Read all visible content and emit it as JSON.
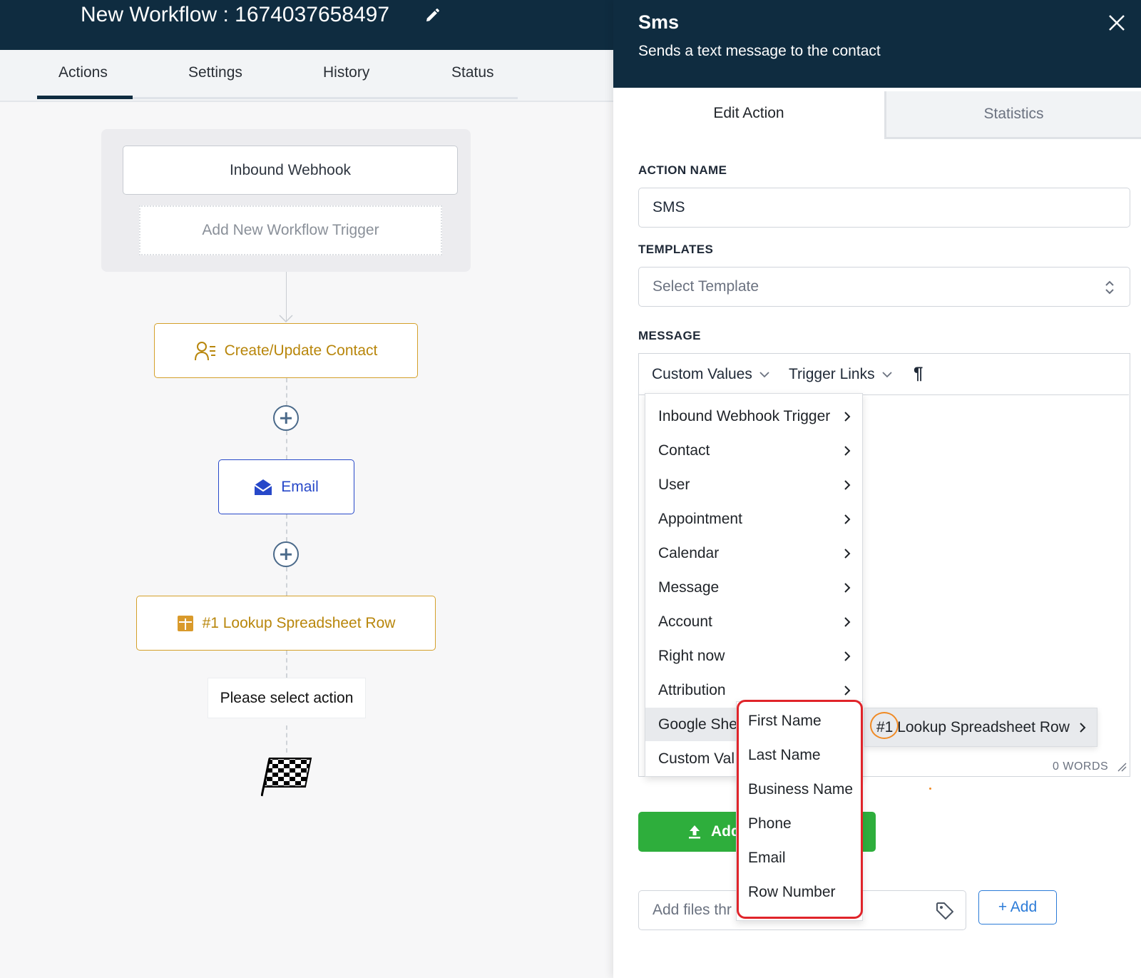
{
  "workflow": {
    "title": "New Workflow : 1674037658497",
    "tabs": [
      "Actions",
      "Settings",
      "History",
      "Status"
    ],
    "active_tab": "Actions",
    "triggers": {
      "webhook_label": "Inbound Webhook",
      "add_trigger_label": "Add New Workflow Trigger"
    },
    "nodes": {
      "create_contact": "Create/Update Contact",
      "email": "Email",
      "lookup": "#1 Lookup Spreadsheet Row",
      "select_action": "Please select action"
    },
    "colors": {
      "header": "#0f2c40",
      "gold": "#b8860b",
      "blue": "#2748c9"
    },
    "icons": [
      "edit-pencil-icon",
      "contact-icon",
      "envelope-icon",
      "spreadsheet-icon",
      "add-step-icon",
      "finish-flag-icon"
    ]
  },
  "panel": {
    "title": "Sms",
    "subtitle": "Sends a text message to the contact",
    "tabs": {
      "edit": "Edit Action",
      "stats": "Statistics"
    },
    "action_name_label": "ACTION NAME",
    "action_name_value": "SMS",
    "templates_label": "TEMPLATES",
    "templates_placeholder": "Select Template",
    "message_label": "MESSAGE",
    "toolbar": {
      "custom_values": "Custom Values",
      "trigger_links": "Trigger Links",
      "paragraph": "¶"
    },
    "word_count": "0 WORDS",
    "upload_label": "Add",
    "attach_placeholder": "Add files thr",
    "add_button": "+ Add",
    "colors": {
      "upload": "#2eae3c",
      "add_button": "#2b7bd8",
      "highlight": "#e0242a",
      "circle": "#f08a24"
    }
  },
  "custom_values_menu": [
    {
      "label": "Inbound Webhook Trigger"
    },
    {
      "label": "Contact"
    },
    {
      "label": "User"
    },
    {
      "label": "Appointment"
    },
    {
      "label": "Calendar"
    },
    {
      "label": "Message"
    },
    {
      "label": "Account"
    },
    {
      "label": "Right now"
    },
    {
      "label": "Attribution"
    },
    {
      "label": "Google She",
      "active": true
    },
    {
      "label": "Custom Val"
    }
  ],
  "google_sheets_submenu": {
    "label": "#1 Lookup Spreadsheet Row"
  },
  "field_menu": [
    "First Name",
    "Last Name",
    "Business Name",
    "Phone",
    "Email",
    "Row Number"
  ]
}
